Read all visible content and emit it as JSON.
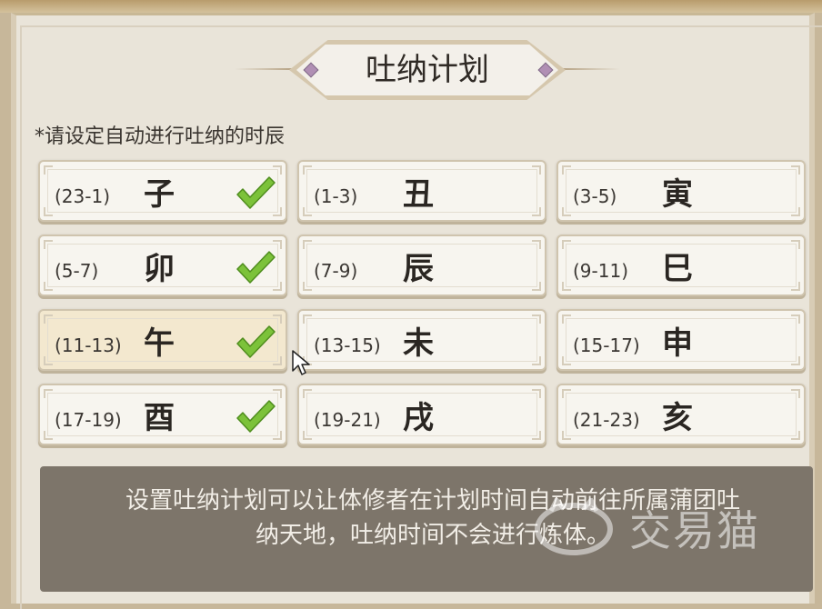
{
  "title": "吐纳计划",
  "subtitle": "*请设定自动进行吐纳的时辰",
  "slots": [
    {
      "range": "(23-1)",
      "branch": "子",
      "checked": true
    },
    {
      "range": "(1-3)",
      "branch": "丑",
      "checked": false
    },
    {
      "range": "(3-5)",
      "branch": "寅",
      "checked": false
    },
    {
      "range": "(5-7)",
      "branch": "卯",
      "checked": true
    },
    {
      "range": "(7-9)",
      "branch": "辰",
      "checked": false
    },
    {
      "range": "(9-11)",
      "branch": "巳",
      "checked": false
    },
    {
      "range": "(11-13)",
      "branch": "午",
      "checked": true
    },
    {
      "range": "(13-15)",
      "branch": "未",
      "checked": false
    },
    {
      "range": "(15-17)",
      "branch": "申",
      "checked": false
    },
    {
      "range": "(17-19)",
      "branch": "酉",
      "checked": true
    },
    {
      "range": "(19-21)",
      "branch": "戌",
      "checked": false
    },
    {
      "range": "(21-23)",
      "branch": "亥",
      "checked": false
    }
  ],
  "info": {
    "line1": "设置吐纳计划可以让体修者在计划时间自动前往所属蒲团吐",
    "line2": "纳天地，吐纳时间不会进行炼体。"
  },
  "watermark": "交易猫",
  "colors": {
    "check": "#7cc23a",
    "panel": "#e9e4d9",
    "info_bg": "#7d756a"
  }
}
